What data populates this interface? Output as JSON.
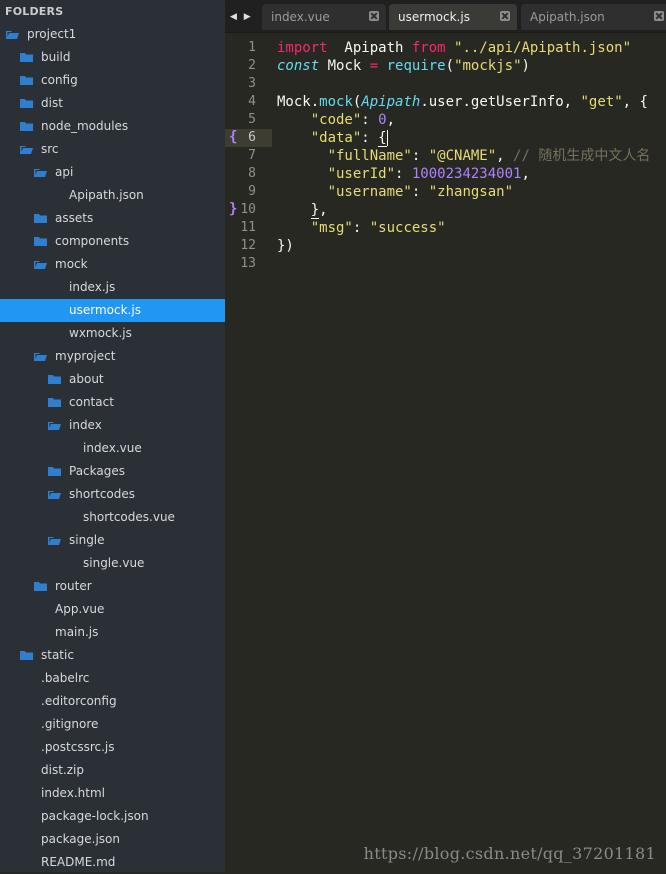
{
  "sidebar": {
    "header": "FOLDERS",
    "tree": [
      {
        "label": "project1",
        "depth": 0,
        "type": "folder",
        "open": true
      },
      {
        "label": "build",
        "depth": 1,
        "type": "folder",
        "open": false
      },
      {
        "label": "config",
        "depth": 1,
        "type": "folder",
        "open": false
      },
      {
        "label": "dist",
        "depth": 1,
        "type": "folder",
        "open": false
      },
      {
        "label": "node_modules",
        "depth": 1,
        "type": "folder",
        "open": false
      },
      {
        "label": "src",
        "depth": 1,
        "type": "folder",
        "open": true
      },
      {
        "label": "api",
        "depth": 2,
        "type": "folder",
        "open": true
      },
      {
        "label": "Apipath.json",
        "depth": 3,
        "type": "file"
      },
      {
        "label": "assets",
        "depth": 2,
        "type": "folder",
        "open": false
      },
      {
        "label": "components",
        "depth": 2,
        "type": "folder",
        "open": false
      },
      {
        "label": "mock",
        "depth": 2,
        "type": "folder",
        "open": true
      },
      {
        "label": "index.js",
        "depth": 3,
        "type": "file"
      },
      {
        "label": "usermock.js",
        "depth": 3,
        "type": "file",
        "selected": true
      },
      {
        "label": "wxmock.js",
        "depth": 3,
        "type": "file"
      },
      {
        "label": "myproject",
        "depth": 2,
        "type": "folder",
        "open": true
      },
      {
        "label": "about",
        "depth": 3,
        "type": "folder",
        "open": false
      },
      {
        "label": "contact",
        "depth": 3,
        "type": "folder",
        "open": false
      },
      {
        "label": "index",
        "depth": 3,
        "type": "folder",
        "open": true
      },
      {
        "label": "index.vue",
        "depth": 4,
        "type": "file"
      },
      {
        "label": "Packages",
        "depth": 3,
        "type": "folder",
        "open": false
      },
      {
        "label": "shortcodes",
        "depth": 3,
        "type": "folder",
        "open": true
      },
      {
        "label": "shortcodes.vue",
        "depth": 4,
        "type": "file"
      },
      {
        "label": "single",
        "depth": 3,
        "type": "folder",
        "open": true
      },
      {
        "label": "single.vue",
        "depth": 4,
        "type": "file"
      },
      {
        "label": "router",
        "depth": 2,
        "type": "folder",
        "open": false
      },
      {
        "label": "App.vue",
        "depth": 2,
        "type": "file"
      },
      {
        "label": "main.js",
        "depth": 2,
        "type": "file"
      },
      {
        "label": "static",
        "depth": 1,
        "type": "folder",
        "open": false
      },
      {
        "label": ".babelrc",
        "depth": 1,
        "type": "file"
      },
      {
        "label": ".editorconfig",
        "depth": 1,
        "type": "file"
      },
      {
        "label": ".gitignore",
        "depth": 1,
        "type": "file"
      },
      {
        "label": ".postcssrc.js",
        "depth": 1,
        "type": "file"
      },
      {
        "label": "dist.zip",
        "depth": 1,
        "type": "file"
      },
      {
        "label": "index.html",
        "depth": 1,
        "type": "file"
      },
      {
        "label": "package-lock.json",
        "depth": 1,
        "type": "file"
      },
      {
        "label": "package.json",
        "depth": 1,
        "type": "file"
      },
      {
        "label": "README.md",
        "depth": 1,
        "type": "file"
      }
    ]
  },
  "tabs": {
    "nav_glyph": "◀ ▶",
    "items": [
      {
        "label": "index.vue",
        "active": false
      },
      {
        "label": "usermock.js",
        "active": true
      },
      {
        "label": "Apipath.json",
        "active": false
      }
    ]
  },
  "editor": {
    "current_line": 6,
    "lines": [
      {
        "n": "1",
        "t": [
          [
            "kw",
            "import"
          ],
          [
            "",
            "  Apipath "
          ],
          [
            "kw",
            "from"
          ],
          [
            "",
            ""
          ],
          [
            "str",
            " \"../api/Apipath.json\""
          ]
        ]
      },
      {
        "n": "2",
        "t": [
          [
            "it",
            "const"
          ],
          [
            "",
            " Mock "
          ],
          [
            "kw",
            "="
          ],
          [
            "",
            " "
          ],
          [
            "blue",
            "require"
          ],
          [
            "",
            "("
          ],
          [
            "str",
            "\"mockjs\""
          ],
          [
            "",
            ")"
          ]
        ]
      },
      {
        "n": "3",
        "t": []
      },
      {
        "n": "4",
        "t": [
          [
            "",
            "Mock."
          ],
          [
            "blue",
            "mock"
          ],
          [
            "",
            "("
          ],
          [
            "it",
            "Apipath"
          ],
          [
            "",
            ".user.getUserInfo, "
          ],
          [
            "str",
            "\"get\""
          ],
          [
            "",
            ", {"
          ]
        ]
      },
      {
        "n": "5",
        "t": [
          [
            "",
            "    "
          ],
          [
            "str",
            "\"code\""
          ],
          [
            "",
            ": "
          ],
          [
            "num",
            "0"
          ],
          [
            "",
            ","
          ]
        ]
      },
      {
        "n": "6",
        "t": [
          [
            "",
            "    "
          ],
          [
            "str",
            "\"data\""
          ],
          [
            "",
            ": "
          ],
          [
            "bm",
            "{"
          ]
        ]
      },
      {
        "n": "7",
        "t": [
          [
            "",
            "      "
          ],
          [
            "str",
            "\"fullName\""
          ],
          [
            "",
            ": "
          ],
          [
            "str",
            "\"@CNAME\""
          ],
          [
            "",
            ", "
          ],
          [
            "com",
            "// 随机生成中文人名"
          ]
        ]
      },
      {
        "n": "8",
        "t": [
          [
            "",
            "      "
          ],
          [
            "str",
            "\"userId\""
          ],
          [
            "",
            ": "
          ],
          [
            "num",
            "1000234234001"
          ],
          [
            "",
            ","
          ]
        ]
      },
      {
        "n": "9",
        "t": [
          [
            "",
            "      "
          ],
          [
            "str",
            "\"username\""
          ],
          [
            "",
            ": "
          ],
          [
            "str",
            "\"zhangsan\""
          ]
        ]
      },
      {
        "n": "10",
        "t": [
          [
            "",
            "    "
          ],
          [
            "bm",
            "}"
          ],
          [
            "",
            ","
          ]
        ]
      },
      {
        "n": "11",
        "t": [
          [
            "",
            "    "
          ],
          [
            "str",
            "\"msg\""
          ],
          [
            "",
            ": "
          ],
          [
            "str",
            "\"success\""
          ]
        ]
      },
      {
        "n": "12",
        "t": [
          [
            "",
            "})"
          ]
        ]
      },
      {
        "n": "13",
        "t": []
      }
    ],
    "fold_markers": [
      {
        "line": 6,
        "glyph": "{"
      },
      {
        "line": 10,
        "glyph": "}"
      }
    ]
  },
  "watermark": "https://blog.csdn.net/qq_37201181",
  "colors": {
    "sidebar_bg": "#2b3037",
    "selection": "#2196f3",
    "editor_bg": "#272822",
    "folder_icon": "#2f7fd1"
  }
}
